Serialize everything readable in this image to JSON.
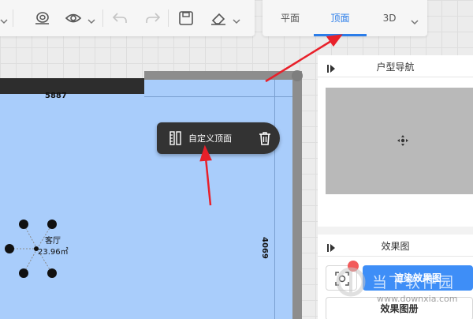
{
  "toolbar": {
    "icons": [
      "grid-icon",
      "ring-icon",
      "eye-icon",
      "undo-icon",
      "redo-icon",
      "save-icon",
      "eraser-icon"
    ]
  },
  "view_tabs": {
    "items": [
      {
        "label": "平面",
        "active": false
      },
      {
        "label": "顶面",
        "active": true
      },
      {
        "label": "3D",
        "active": false
      }
    ]
  },
  "floorplan": {
    "dimension_top": "5887",
    "dimension_right": "4069",
    "room": {
      "name": "客厅",
      "area": "23.96㎡"
    },
    "popup": {
      "label": "自定义顶面",
      "icon_left": "ruler-icon",
      "icon_right": "trash-icon"
    }
  },
  "right_panel": {
    "nav_title": "户型导航",
    "render_title": "效果图",
    "render_button": "渲染效果图",
    "album_button": "效果图册"
  },
  "watermark": {
    "text": "当下软件园",
    "url": "www.downxia.com"
  },
  "colors": {
    "accent": "#2b7de9",
    "room_fill": "#a9cdfb",
    "annotation": "#e8202a",
    "popup_bg": "#333333"
  }
}
